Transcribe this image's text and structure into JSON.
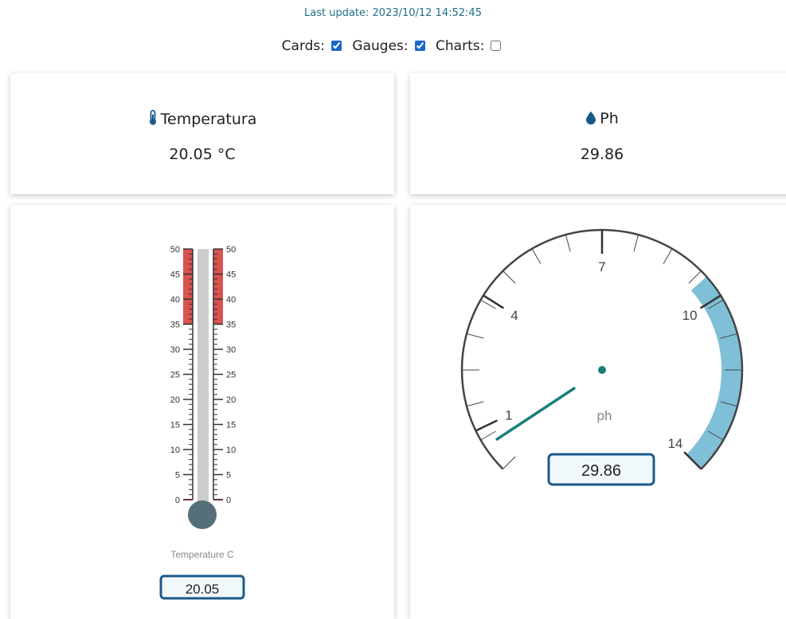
{
  "header": {
    "last_update": "Last update: 2023/10/12 14:52:45"
  },
  "toggles": [
    {
      "label": "Cards:",
      "checked": true
    },
    {
      "label": "Gauges:",
      "checked": true
    },
    {
      "label": "Charts:",
      "checked": false
    }
  ],
  "cards": {
    "temperature": {
      "title": "Temperatura",
      "value": "20.05 °C",
      "icon": "thermometer-icon"
    },
    "ph": {
      "title": "Ph",
      "value": "29.86",
      "icon": "droplet-icon"
    }
  },
  "thermometer_gauge": {
    "label": "Temperature C",
    "value": 20.05,
    "display_value": "20.05",
    "min": 0,
    "max": 50,
    "ticks": [
      "0",
      "5",
      "10",
      "15",
      "20",
      "25",
      "30",
      "35",
      "40",
      "45",
      "50"
    ],
    "high_zone_start": 35
  },
  "ph_gauge": {
    "unit_label": "ph",
    "value": 29.86,
    "display_value": "29.86",
    "min": 0,
    "max": 14,
    "ticks": [
      "1",
      "4",
      "7",
      "10",
      "14"
    ],
    "highlight_start": 9.5,
    "highlight_end": 14
  },
  "colors": {
    "accent": "#1a66c9",
    "header_text": "#1f6f8b",
    "danger_zone": "#d9534f",
    "thermo_fill": "#cccccc",
    "bulb": "#546e7a",
    "needle": "#1a7f7a",
    "ph_highlight": "#7fbfd8",
    "value_box_border": "#1a5a8a"
  }
}
